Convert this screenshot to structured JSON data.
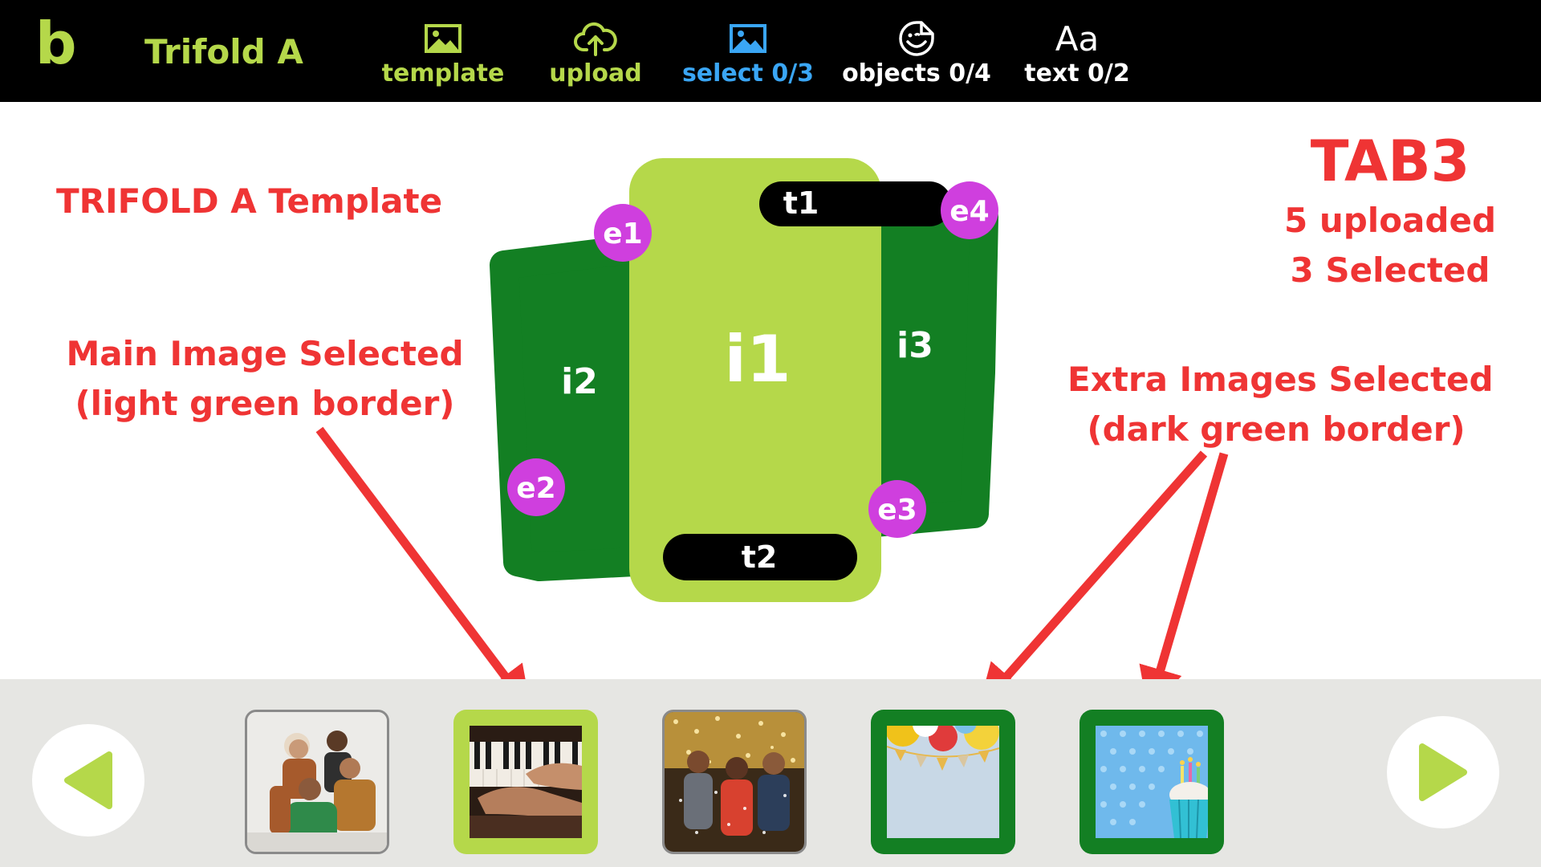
{
  "header": {
    "logo": "b",
    "title": "Trifold A",
    "nav": [
      {
        "label": "template",
        "icon": "image-icon",
        "color": "#b5d84a"
      },
      {
        "label": "upload",
        "icon": "cloud-upload-icon",
        "color": "#b5d84a"
      },
      {
        "label": "select 0/3",
        "icon": "image-icon",
        "color": "#3aa6f5",
        "active": true
      },
      {
        "label": "objects 0/4",
        "icon": "smiley-sticker-icon",
        "color": "#ffffff"
      },
      {
        "label": "text 0/2",
        "icon": "text-aa-icon",
        "color": "#ffffff",
        "icon_text": "Aa"
      }
    ]
  },
  "annotations": {
    "template_name": "TRIFOLD A Template",
    "tab": "TAB3",
    "uploaded": "5 uploaded",
    "selected": "3 Selected",
    "main_line1": "Main Image Selected",
    "main_line2": "(light green border)",
    "extra_line1": "Extra Images Selected",
    "extra_line2": "(dark green border)"
  },
  "template": {
    "images": [
      "i1",
      "i2",
      "i3"
    ],
    "texts": [
      "t1",
      "t2"
    ],
    "extras": [
      "e1",
      "e2",
      "e3",
      "e4"
    ]
  },
  "tray": {
    "prev_icon": "triangle-left-icon",
    "next_icon": "triangle-right-icon",
    "thumbnails": [
      {
        "subject": "group of friends",
        "state": "normal"
      },
      {
        "subject": "hands playing piano",
        "state": "main"
      },
      {
        "subject": "party confetti",
        "state": "normal"
      },
      {
        "subject": "balloons and bunting",
        "state": "extra"
      },
      {
        "subject": "birthday cupcake with candles",
        "state": "extra"
      }
    ]
  },
  "colors": {
    "light_green": "#b5d84a",
    "dark_green": "#137f23",
    "badge_purple": "#cf3fde",
    "annotation_red": "#ef3434",
    "select_blue": "#3aa6f5"
  }
}
